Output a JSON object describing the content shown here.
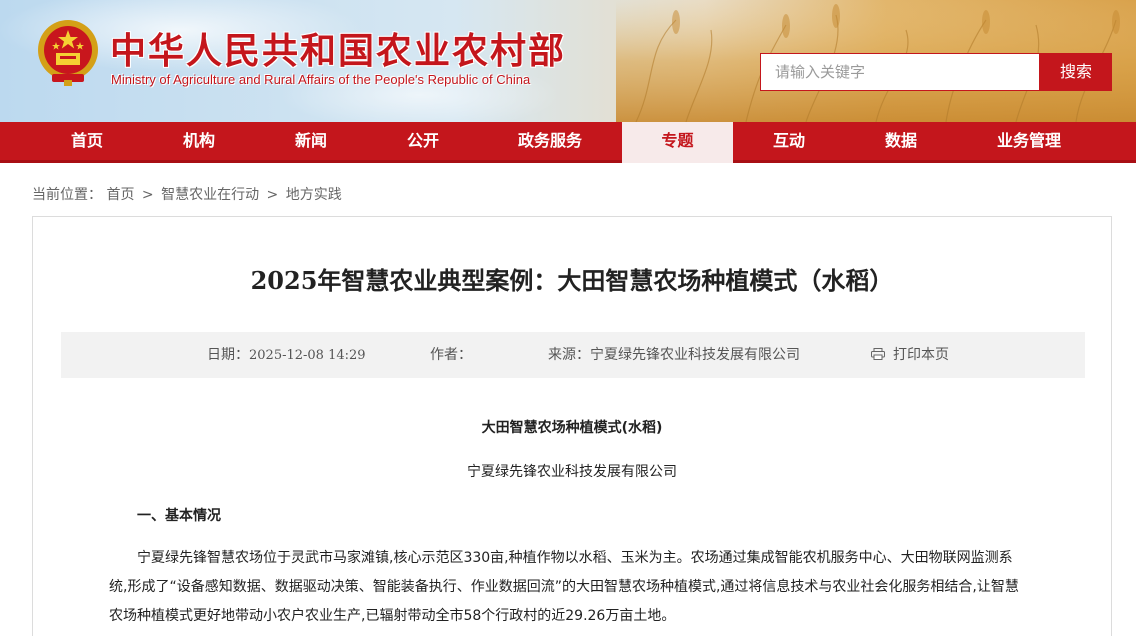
{
  "header": {
    "title": "中华人民共和国农业农村部",
    "subtitle": "Ministry of Agriculture and Rural Affairs of the People's Republic of China",
    "emblem_icon": "national-emblem-icon",
    "search": {
      "placeholder": "请输入关键字",
      "button_label": "搜索"
    },
    "brand_color": "#c4161c"
  },
  "nav": {
    "items": [
      {
        "label": "首页"
      },
      {
        "label": "机构"
      },
      {
        "label": "新闻"
      },
      {
        "label": "公开"
      },
      {
        "label": "政务服务"
      },
      {
        "label": "专题",
        "active": true
      },
      {
        "label": "互动"
      },
      {
        "label": "数据"
      },
      {
        "label": "业务管理"
      }
    ]
  },
  "breadcrumb": {
    "prefix": "当前位置：",
    "items": [
      "首页",
      "智慧农业在行动",
      "地方实践"
    ],
    "separator": ">"
  },
  "article": {
    "title": "2025年智慧农业典型案例：大田智慧农场种植模式（水稻）",
    "meta": {
      "date_label": "日期：",
      "date_value": "2025-12-08 14:29",
      "author_label": "作者：",
      "author_value": "",
      "source_label": "来源：",
      "source_value": "宁夏绿先锋农业科技发展有限公司",
      "print_icon": "printer-icon",
      "print_label": "打印本页"
    },
    "content": {
      "heading": "大田智慧农场种植模式(水稻)",
      "organization": "宁夏绿先锋农业科技发展有限公司",
      "section_1_title": "一、基本情况",
      "paragraph_1": "宁夏绿先锋智慧农场位于灵武市马家滩镇,核心示范区330亩,种植作物以水稻、玉米为主。农场通过集成智能农机服务中心、大田物联网监测系统,形成了“设备感知数据、数据驱动决策、智能装备执行、作业数据回流”的大田智慧农场种植模式,通过将信息技术与农业社会化服务相结合,让智慧农场种植模式更好地带动小农户农业生产,已辐射带动全市58个行政村的近29.26万亩土地。"
    }
  }
}
